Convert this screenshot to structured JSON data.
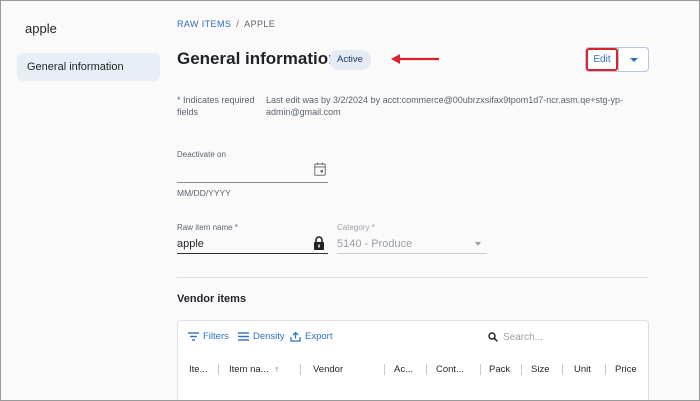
{
  "sidebar": {
    "title": "apple",
    "items": [
      {
        "label": "General information"
      }
    ]
  },
  "breadcrumb": {
    "parent": "RAW ITEMS",
    "separator": "/",
    "current": "APPLE"
  },
  "header": {
    "title": "General information",
    "status": "Active",
    "edit_label": "Edit"
  },
  "notes": {
    "required": "* Indicates required fields",
    "last_edit": "Last edit was by 3/2/2024 by acct:commerce@00ubrzxsifax9tpom1d7-ncr.asm.qe+stg-yp-admin@gmail.com"
  },
  "deactivate": {
    "label": "Deactivate on",
    "value": "",
    "helper": "MM/DD/YYYY"
  },
  "raw_item": {
    "label": "Raw item name *",
    "value": "apple"
  },
  "category": {
    "label": "Category *",
    "value": "5140 - Produce"
  },
  "vendor_items": {
    "title": "Vendor items",
    "toolbar": {
      "filters": "Filters",
      "density": "Density",
      "export": "Export"
    },
    "search_placeholder": "Search...",
    "columns": [
      "Ite...",
      "Item na...",
      "Vendor",
      "Ac...",
      "Cont...",
      "Pack",
      "Size",
      "Unit",
      "Price"
    ]
  },
  "colors": {
    "accent": "#2f6fc0",
    "annotation_red": "#d9232e",
    "badge_bg": "#e4ebf5"
  },
  "icons": {
    "calendar": "calendar-icon",
    "lock": "lock-icon",
    "search": "search-icon",
    "filters": "filter-icon",
    "density": "density-icon",
    "export": "export-icon",
    "sort": "sort-up-icon"
  }
}
